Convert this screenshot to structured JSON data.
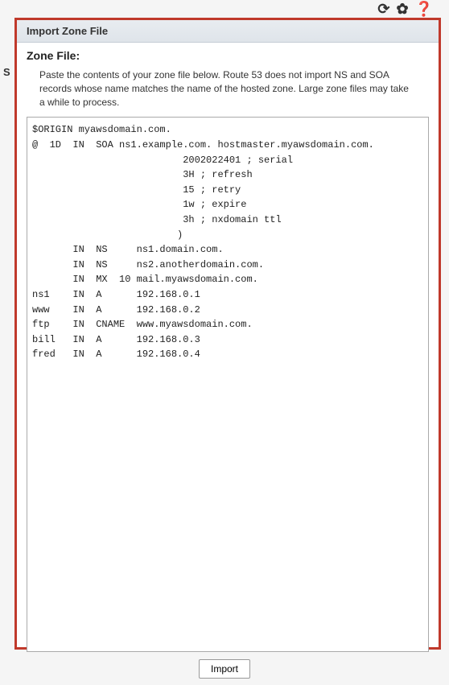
{
  "header_icons": {
    "refresh": "⟳",
    "settings": "✿",
    "help": "❓"
  },
  "side_letter": "S",
  "dialog": {
    "title": "Import Zone File",
    "section_label": "Zone File:",
    "instructions": "Paste the contents of your zone file below. Route 53 does not import NS and SOA records whose name matches the name of the hosted zone. Large zone files may take a while to process."
  },
  "zone_file_content": "$ORIGIN myawsdomain.com.\n@  1D  IN  SOA ns1.example.com. hostmaster.myawsdomain.com.\n                          2002022401 ; serial\n                          3H ; refresh\n                          15 ; retry\n                          1w ; expire\n                          3h ; nxdomain ttl\n                         )\n       IN  NS     ns1.domain.com.\n       IN  NS     ns2.anotherdomain.com.\n       IN  MX  10 mail.myawsdomain.com.\nns1    IN  A      192.168.0.1\nwww    IN  A      192.168.0.2\nftp    IN  CNAME  www.myawsdomain.com.\nbill   IN  A      192.168.0.3\nfred   IN  A      192.168.0.4",
  "import_button_label": "Import"
}
